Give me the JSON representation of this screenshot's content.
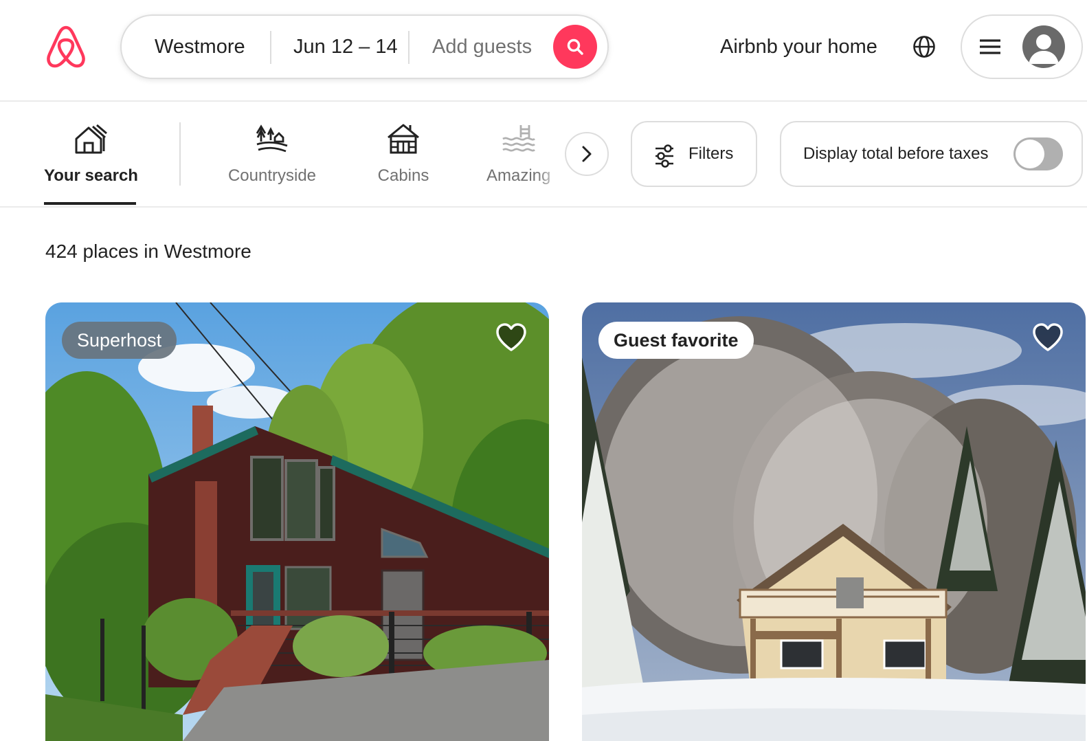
{
  "header": {
    "search": {
      "where": "Westmore",
      "dates": "Jun 12 – 14",
      "guests_placeholder": "Add guests"
    },
    "host_link": "Airbnb your home",
    "icons": {
      "logo": "airbnb-logo",
      "search": "search-icon",
      "globe": "globe-icon",
      "menu": "hamburger-icon",
      "avatar": "user-avatar"
    }
  },
  "categories": {
    "items": [
      {
        "label": "Your search",
        "icon": "house-search-icon",
        "active": true
      },
      {
        "label": "Countryside",
        "icon": "countryside-icon",
        "active": false
      },
      {
        "label": "Cabins",
        "icon": "cabin-icon",
        "active": false
      },
      {
        "label": "Amazing",
        "icon": "pool-icon",
        "active": false
      }
    ],
    "filters_label": "Filters",
    "taxes_label": "Display total before taxes",
    "taxes_toggle_on": false
  },
  "results": {
    "count_text": "424 places in Westmore",
    "listings": [
      {
        "badge": "Superhost",
        "favorited": false
      },
      {
        "badge": "Guest favorite",
        "favorited": false
      }
    ]
  },
  "colors": {
    "brand": "#ff385c",
    "text": "#222222",
    "muted": "#717171",
    "border": "#dddddd"
  }
}
